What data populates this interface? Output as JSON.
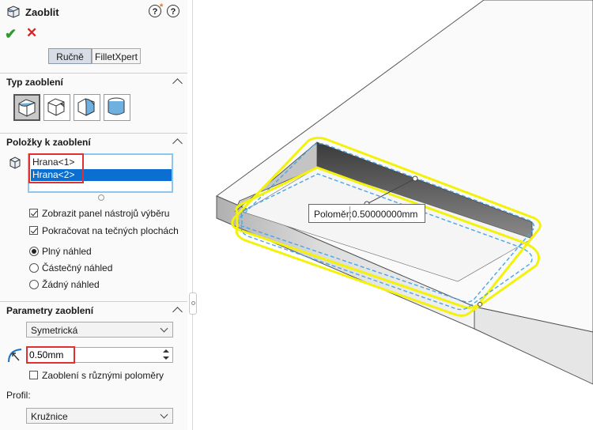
{
  "panel": {
    "title": "Zaoblit",
    "help_label": "?",
    "mode_tabs": [
      "Ručně",
      "FilletXpert"
    ],
    "active_tab": 0
  },
  "fillet_type": {
    "header": "Typ zaoblení",
    "buttons": [
      "constant-size-fillet-icon",
      "variable-size-fillet-icon",
      "face-fillet-icon",
      "full-round-fillet-icon"
    ],
    "selected": 0
  },
  "items": {
    "header": "Položky k zaoblení",
    "list": [
      "Hrana<1>",
      "Hrana<2>"
    ],
    "selected_index": 1,
    "show_toolbar_label": "Zobrazit panel nástrojů výběru",
    "show_toolbar_checked": true,
    "tangent_label": "Pokračovat na tečných plochách",
    "tangent_checked": true,
    "preview_options": [
      "Plný náhled",
      "Částečný náhled",
      "Žádný náhled"
    ],
    "preview_selected": 0
  },
  "params": {
    "header": "Parametry zaoblení",
    "symmetry_value": "Symetrická",
    "radius_value": "0.50mm",
    "multi_radius_label": "Zaoblení s různými poloměry",
    "multi_radius_checked": false,
    "profile_label": "Profil:",
    "profile_value": "Kružnice"
  },
  "viewport": {
    "dim_label": "Poloměr:",
    "dim_value": "0.50000000mm"
  },
  "colors": {
    "accent_selection": "#0a6fd1",
    "highlight_red": "#e03030",
    "edge_yellow": "#f2f20a",
    "edge_blue": "#4aa6e6"
  }
}
